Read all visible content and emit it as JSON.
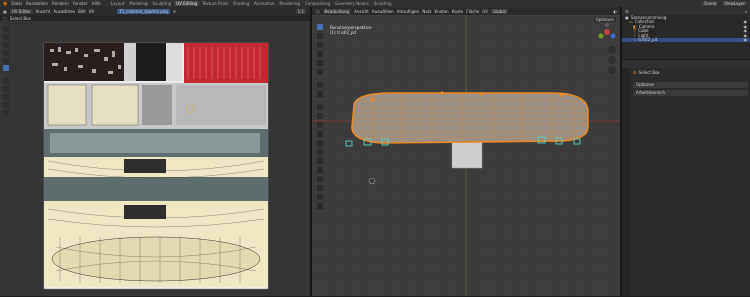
{
  "menu": [
    "Datei",
    "Bearbeiten",
    "Rendern",
    "Fenster",
    "Hilfe"
  ],
  "workspaces": [
    {
      "label": "Layout",
      "active": false
    },
    {
      "label": "Modeling",
      "active": false
    },
    {
      "label": "Sculpting",
      "active": false
    },
    {
      "label": "UV Editing",
      "active": true
    },
    {
      "label": "Texture Paint",
      "active": false
    },
    {
      "label": "Shading",
      "active": false
    },
    {
      "label": "Animation",
      "active": false
    },
    {
      "label": "Rendering",
      "active": false
    },
    {
      "label": "Compositing",
      "active": false
    },
    {
      "label": "Geometry Nodes",
      "active": false
    },
    {
      "label": "Scripting",
      "active": false
    }
  ],
  "scene_name": "Scene",
  "view_layer": "ViewLayer",
  "uv_editor": {
    "mode": "UV Editor",
    "menus": [
      "Ansicht",
      "Auswählen",
      "Bild",
      "UV"
    ],
    "image_name": "T1_cisterne_sparms.png",
    "select_mode_label": "Select Box",
    "zoom": "1:1"
  },
  "viewport": {
    "mode": "Bearbeitung",
    "menus": [
      "Ansicht",
      "Auswählen",
      "Hinzufügen",
      "Netz",
      "Knoten",
      "Kante",
      "Fläche",
      "UV"
    ],
    "view_label": "Benutzerperspektive",
    "object_label": "(1) tcis02_pit",
    "transform_orientation": "Global",
    "options_label": "Optionen"
  },
  "outliner": {
    "title": "Szenensammlung",
    "items": [
      {
        "label": "Collection",
        "indent": 1,
        "icon": "collection-icon",
        "selected": false
      },
      {
        "label": "Camera",
        "indent": 2,
        "icon": "camera-icon",
        "selected": false
      },
      {
        "label": "Cube",
        "indent": 2,
        "icon": "mesh-icon",
        "selected": false
      },
      {
        "label": "Light",
        "indent": 2,
        "icon": "light-icon",
        "selected": false
      },
      {
        "label": "tcis02_pit",
        "indent": 2,
        "icon": "mesh-icon",
        "selected": true
      }
    ]
  },
  "properties": {
    "header_label": "Select Box",
    "panels": [
      "Optionen",
      "Arbeitsbereich"
    ]
  },
  "colors": {
    "accent": "#4772b3",
    "edit_orange": "#e78a2b",
    "uv_sheet": "#e8e4d5",
    "red_block": "#c4272f"
  }
}
